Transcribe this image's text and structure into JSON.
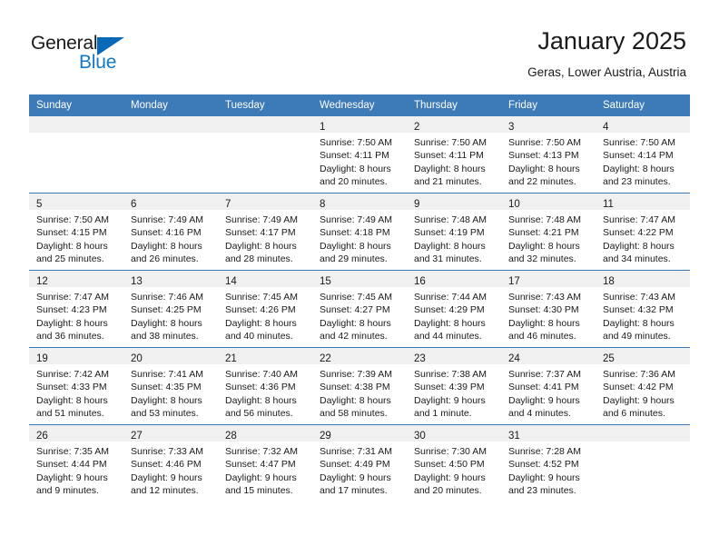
{
  "brand": {
    "line1": "General",
    "line2": "Blue",
    "triangle_color": "#0a68b8",
    "blue_text_color": "#1378c8"
  },
  "header": {
    "title": "January 2025",
    "subtitle": "Geras, Lower Austria, Austria"
  },
  "theme": {
    "header_blue": "#3d7ab8",
    "daynum_band": "#f0f0f0",
    "text": "#1a1a1a"
  },
  "weekdays": [
    "Sunday",
    "Monday",
    "Tuesday",
    "Wednesday",
    "Thursday",
    "Friday",
    "Saturday"
  ],
  "weeks": [
    [
      {
        "day": "",
        "lines": []
      },
      {
        "day": "",
        "lines": []
      },
      {
        "day": "",
        "lines": []
      },
      {
        "day": "1",
        "lines": [
          "Sunrise: 7:50 AM",
          "Sunset: 4:11 PM",
          "Daylight: 8 hours",
          "and 20 minutes."
        ]
      },
      {
        "day": "2",
        "lines": [
          "Sunrise: 7:50 AM",
          "Sunset: 4:11 PM",
          "Daylight: 8 hours",
          "and 21 minutes."
        ]
      },
      {
        "day": "3",
        "lines": [
          "Sunrise: 7:50 AM",
          "Sunset: 4:13 PM",
          "Daylight: 8 hours",
          "and 22 minutes."
        ]
      },
      {
        "day": "4",
        "lines": [
          "Sunrise: 7:50 AM",
          "Sunset: 4:14 PM",
          "Daylight: 8 hours",
          "and 23 minutes."
        ]
      }
    ],
    [
      {
        "day": "5",
        "lines": [
          "Sunrise: 7:50 AM",
          "Sunset: 4:15 PM",
          "Daylight: 8 hours",
          "and 25 minutes."
        ]
      },
      {
        "day": "6",
        "lines": [
          "Sunrise: 7:49 AM",
          "Sunset: 4:16 PM",
          "Daylight: 8 hours",
          "and 26 minutes."
        ]
      },
      {
        "day": "7",
        "lines": [
          "Sunrise: 7:49 AM",
          "Sunset: 4:17 PM",
          "Daylight: 8 hours",
          "and 28 minutes."
        ]
      },
      {
        "day": "8",
        "lines": [
          "Sunrise: 7:49 AM",
          "Sunset: 4:18 PM",
          "Daylight: 8 hours",
          "and 29 minutes."
        ]
      },
      {
        "day": "9",
        "lines": [
          "Sunrise: 7:48 AM",
          "Sunset: 4:19 PM",
          "Daylight: 8 hours",
          "and 31 minutes."
        ]
      },
      {
        "day": "10",
        "lines": [
          "Sunrise: 7:48 AM",
          "Sunset: 4:21 PM",
          "Daylight: 8 hours",
          "and 32 minutes."
        ]
      },
      {
        "day": "11",
        "lines": [
          "Sunrise: 7:47 AM",
          "Sunset: 4:22 PM",
          "Daylight: 8 hours",
          "and 34 minutes."
        ]
      }
    ],
    [
      {
        "day": "12",
        "lines": [
          "Sunrise: 7:47 AM",
          "Sunset: 4:23 PM",
          "Daylight: 8 hours",
          "and 36 minutes."
        ]
      },
      {
        "day": "13",
        "lines": [
          "Sunrise: 7:46 AM",
          "Sunset: 4:25 PM",
          "Daylight: 8 hours",
          "and 38 minutes."
        ]
      },
      {
        "day": "14",
        "lines": [
          "Sunrise: 7:45 AM",
          "Sunset: 4:26 PM",
          "Daylight: 8 hours",
          "and 40 minutes."
        ]
      },
      {
        "day": "15",
        "lines": [
          "Sunrise: 7:45 AM",
          "Sunset: 4:27 PM",
          "Daylight: 8 hours",
          "and 42 minutes."
        ]
      },
      {
        "day": "16",
        "lines": [
          "Sunrise: 7:44 AM",
          "Sunset: 4:29 PM",
          "Daylight: 8 hours",
          "and 44 minutes."
        ]
      },
      {
        "day": "17",
        "lines": [
          "Sunrise: 7:43 AM",
          "Sunset: 4:30 PM",
          "Daylight: 8 hours",
          "and 46 minutes."
        ]
      },
      {
        "day": "18",
        "lines": [
          "Sunrise: 7:43 AM",
          "Sunset: 4:32 PM",
          "Daylight: 8 hours",
          "and 49 minutes."
        ]
      }
    ],
    [
      {
        "day": "19",
        "lines": [
          "Sunrise: 7:42 AM",
          "Sunset: 4:33 PM",
          "Daylight: 8 hours",
          "and 51 minutes."
        ]
      },
      {
        "day": "20",
        "lines": [
          "Sunrise: 7:41 AM",
          "Sunset: 4:35 PM",
          "Daylight: 8 hours",
          "and 53 minutes."
        ]
      },
      {
        "day": "21",
        "lines": [
          "Sunrise: 7:40 AM",
          "Sunset: 4:36 PM",
          "Daylight: 8 hours",
          "and 56 minutes."
        ]
      },
      {
        "day": "22",
        "lines": [
          "Sunrise: 7:39 AM",
          "Sunset: 4:38 PM",
          "Daylight: 8 hours",
          "and 58 minutes."
        ]
      },
      {
        "day": "23",
        "lines": [
          "Sunrise: 7:38 AM",
          "Sunset: 4:39 PM",
          "Daylight: 9 hours",
          "and 1 minute."
        ]
      },
      {
        "day": "24",
        "lines": [
          "Sunrise: 7:37 AM",
          "Sunset: 4:41 PM",
          "Daylight: 9 hours",
          "and 4 minutes."
        ]
      },
      {
        "day": "25",
        "lines": [
          "Sunrise: 7:36 AM",
          "Sunset: 4:42 PM",
          "Daylight: 9 hours",
          "and 6 minutes."
        ]
      }
    ],
    [
      {
        "day": "26",
        "lines": [
          "Sunrise: 7:35 AM",
          "Sunset: 4:44 PM",
          "Daylight: 9 hours",
          "and 9 minutes."
        ]
      },
      {
        "day": "27",
        "lines": [
          "Sunrise: 7:33 AM",
          "Sunset: 4:46 PM",
          "Daylight: 9 hours",
          "and 12 minutes."
        ]
      },
      {
        "day": "28",
        "lines": [
          "Sunrise: 7:32 AM",
          "Sunset: 4:47 PM",
          "Daylight: 9 hours",
          "and 15 minutes."
        ]
      },
      {
        "day": "29",
        "lines": [
          "Sunrise: 7:31 AM",
          "Sunset: 4:49 PM",
          "Daylight: 9 hours",
          "and 17 minutes."
        ]
      },
      {
        "day": "30",
        "lines": [
          "Sunrise: 7:30 AM",
          "Sunset: 4:50 PM",
          "Daylight: 9 hours",
          "and 20 minutes."
        ]
      },
      {
        "day": "31",
        "lines": [
          "Sunrise: 7:28 AM",
          "Sunset: 4:52 PM",
          "Daylight: 9 hours",
          "and 23 minutes."
        ]
      },
      {
        "day": "",
        "lines": []
      }
    ]
  ]
}
